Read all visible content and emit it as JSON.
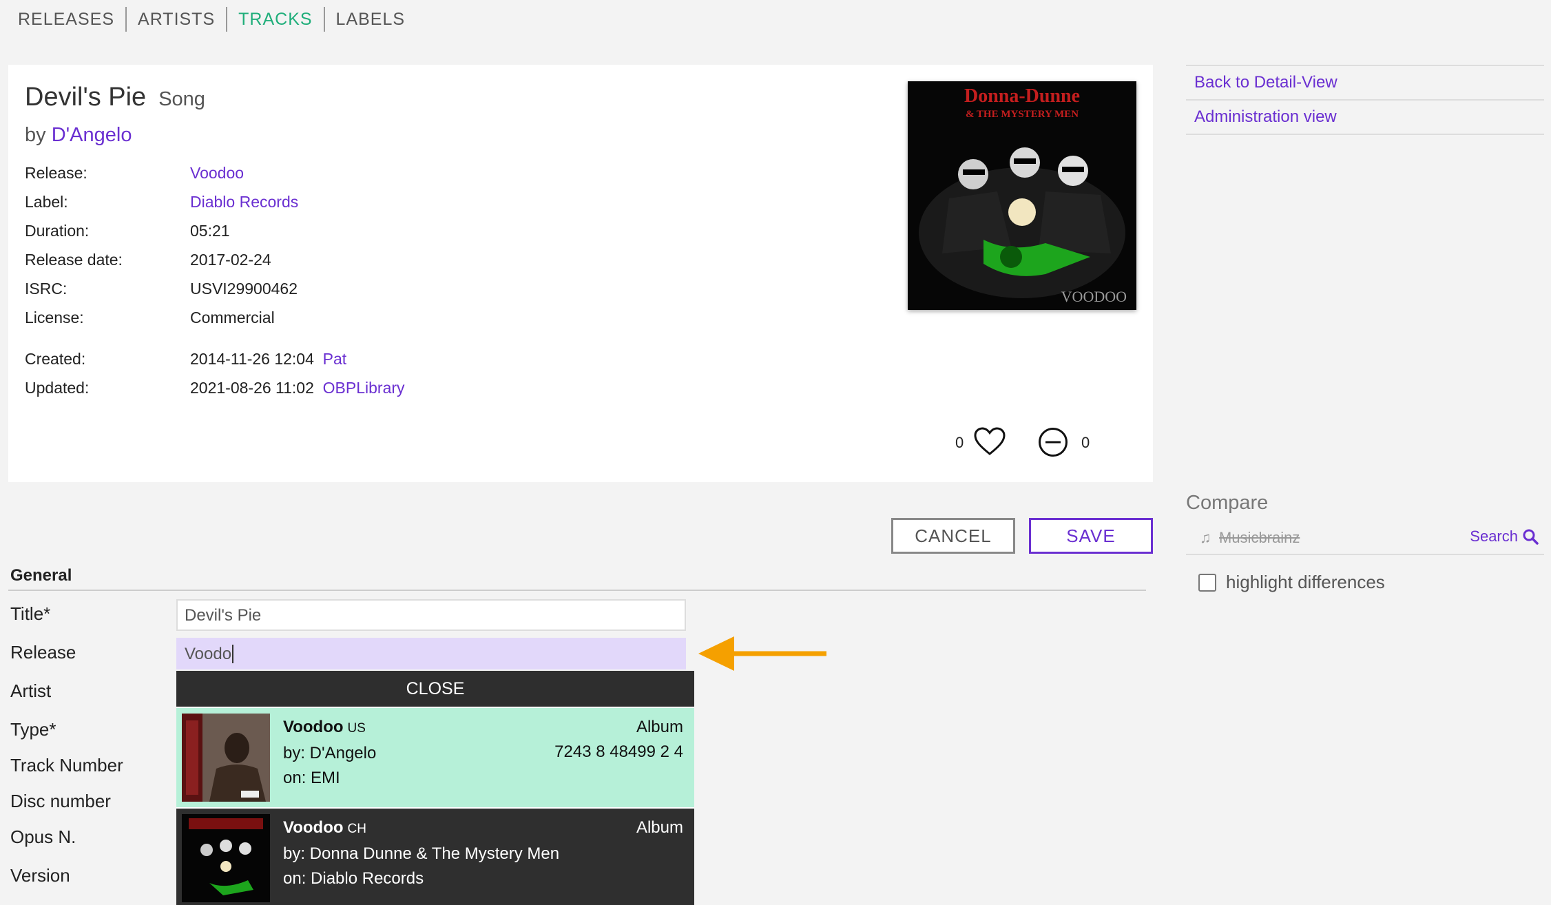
{
  "nav": {
    "items": [
      "RELEASES",
      "ARTISTS",
      "TRACKS",
      "LABELS"
    ],
    "active_index": 2,
    "active_color": "#1fae7a"
  },
  "track": {
    "title": "Devil's Pie",
    "type": "Song",
    "by_prefix": "by",
    "artist": "D'Angelo",
    "fields": [
      {
        "key": "Release:",
        "value": "Voodoo",
        "link": true
      },
      {
        "key": "Label:",
        "value": "Diablo Records",
        "link": true
      },
      {
        "key": "Duration:",
        "value": "05:21",
        "link": false
      },
      {
        "key": "Release date:",
        "value": "2017-02-24",
        "link": false
      },
      {
        "key": "ISRC:",
        "value": "USVI29900462",
        "link": false
      },
      {
        "key": "License:",
        "value": "Commercial",
        "link": false
      }
    ],
    "created": {
      "key": "Created:",
      "date": "2014-11-26 12:04",
      "user": "Pat"
    },
    "updated": {
      "key": "Updated:",
      "date": "2021-08-26 11:02",
      "user": "OBPLibrary"
    },
    "likes": "0",
    "dislikes": "0",
    "cover": {
      "title_text": "Donna-Dunne",
      "subtitle_text": "& THE MYSTERY MEN",
      "footer_text": "VOODOO"
    }
  },
  "side": {
    "links": [
      "Back to Detail-View",
      "Administration view"
    ],
    "compare_title": "Compare",
    "compare_source": "Musicbrainz",
    "search_label": "Search",
    "highlight_label": "highlight differences"
  },
  "buttons": {
    "cancel": "CANCEL",
    "save": "SAVE"
  },
  "form": {
    "section": "General",
    "labels": [
      "Title*",
      "Release",
      "Artist",
      "Type*",
      "Track Number",
      "Disc number",
      "Opus N.",
      "Version"
    ],
    "title_value": "Devil's Pie",
    "release_value": "Voodo"
  },
  "dropdown": {
    "close_label": "CLOSE",
    "items": [
      {
        "name": "Voodoo",
        "country": "US",
        "by": "by: D'Angelo",
        "on": "on: EMI",
        "kind": "Album",
        "code": "7243 8 48499 2 4"
      },
      {
        "name": "Voodoo",
        "country": "CH",
        "by": "by: Donna Dunne & The Mystery Men",
        "on": "on: Diablo Records",
        "kind": "Album",
        "code": ""
      }
    ]
  },
  "colors": {
    "link": "#6a2fd1",
    "highlight_row": "#b6f0d8",
    "active_input": "#e2d8fa",
    "arrow": "#f5a000"
  }
}
